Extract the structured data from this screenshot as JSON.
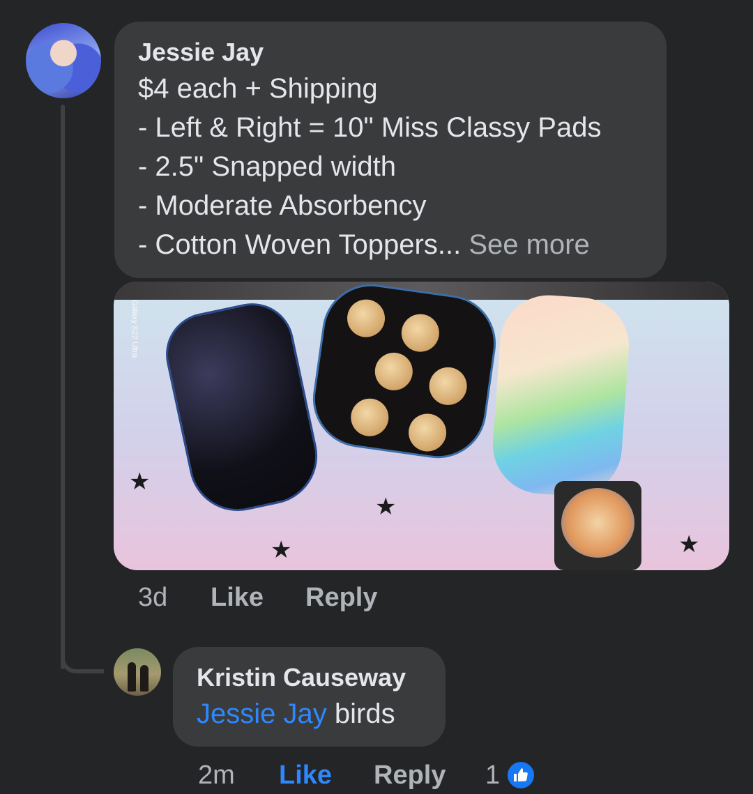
{
  "comment": {
    "author": "Jessie Jay",
    "lines": [
      "$4 each + Shipping",
      "- Left & Right = 10\" Miss Classy Pads",
      "- 2.5\" Snapped width",
      "- Moderate Absorbency",
      "- Cotton Woven Toppers..."
    ],
    "see_more": " See more",
    "photo_watermark": "Galaxy S22 Ultra",
    "time": "3d",
    "like_label": "Like",
    "reply_label": "Reply"
  },
  "reply": {
    "author": "Kristin Causeway",
    "mention": "Jessie Jay",
    "text": " birds",
    "time": "2m",
    "like_label": "Like",
    "reply_label": "Reply",
    "reaction_count": "1",
    "reaction_icon": "thumbs-up-icon",
    "like_color": "#2d88ff"
  }
}
